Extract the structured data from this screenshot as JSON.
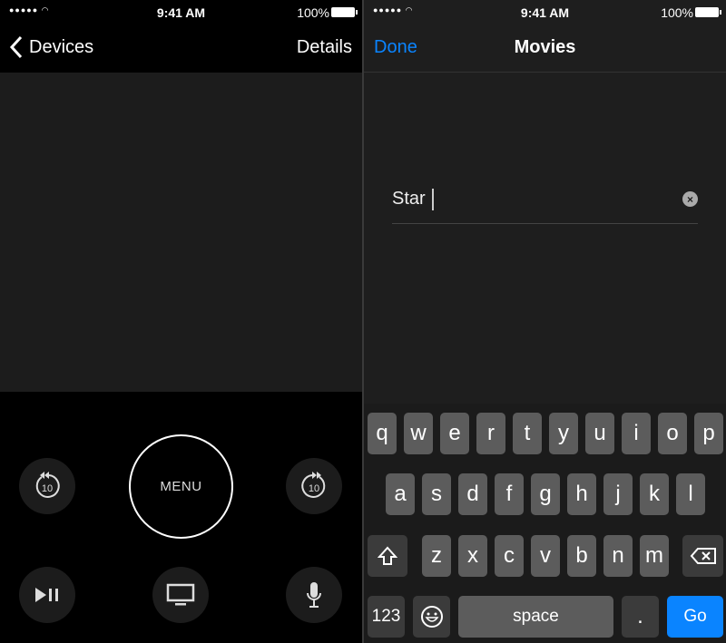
{
  "status": {
    "time": "9:41 AM",
    "battery": "100%"
  },
  "left": {
    "back_label": "Devices",
    "details_label": "Details",
    "menu_label": "MENU",
    "skip_back": "10",
    "skip_forward": "10"
  },
  "right": {
    "done_label": "Done",
    "title": "Movies",
    "search_value": "Star"
  },
  "keyboard": {
    "row1": [
      "q",
      "w",
      "e",
      "r",
      "t",
      "y",
      "u",
      "i",
      "o",
      "p"
    ],
    "row2": [
      "a",
      "s",
      "d",
      "f",
      "g",
      "h",
      "j",
      "k",
      "l"
    ],
    "row3": [
      "z",
      "x",
      "c",
      "v",
      "b",
      "n",
      "m"
    ],
    "numbers": "123",
    "space": "space",
    "period": ".",
    "go": "Go"
  },
  "colors": {
    "accent": "#0a84ff"
  }
}
